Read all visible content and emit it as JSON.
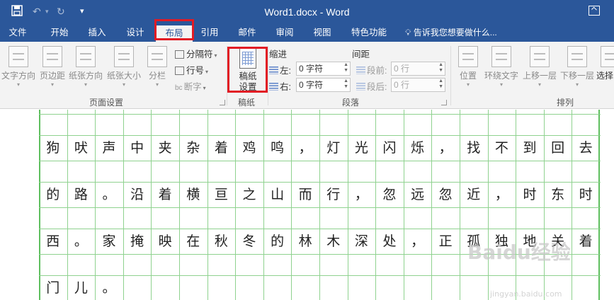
{
  "window": {
    "title": "Word1.docx - Word"
  },
  "tabs": [
    {
      "label": "文件"
    },
    {
      "label": "开始"
    },
    {
      "label": "插入"
    },
    {
      "label": "设计"
    },
    {
      "label": "布局",
      "active": true
    },
    {
      "label": "引用"
    },
    {
      "label": "邮件"
    },
    {
      "label": "审阅"
    },
    {
      "label": "视图"
    },
    {
      "label": "特色功能"
    }
  ],
  "tell_me": "告诉我您想要做什么...",
  "ribbon": {
    "page_setup": {
      "group_label": "页面设置",
      "buttons": [
        "文字方向",
        "页边距",
        "纸张方向",
        "纸张大小",
        "分栏"
      ],
      "breaks": "分隔符",
      "line_numbers": "行号",
      "hyphenation": "断字"
    },
    "manuscript": {
      "group_label": "稿纸",
      "button_line1": "稿纸",
      "button_line2": "设置"
    },
    "paragraph": {
      "group_label": "段落",
      "indent_title": "缩进",
      "spacing_title": "间距",
      "left_label": "左:",
      "left_value": "0 字符",
      "right_label": "右:",
      "right_value": "0 字符",
      "before_label": "段前:",
      "before_value": "0 行",
      "after_label": "段后:",
      "after_value": "0 行"
    },
    "arrange": {
      "group_label": "排列",
      "buttons": [
        "位置",
        "环绕文字",
        "上移一层",
        "下移一层",
        "选择"
      ]
    }
  },
  "document": {
    "rows": [
      [
        "狗",
        "吠",
        "声",
        "中",
        "夹",
        "杂",
        "着",
        "鸡",
        "鸣",
        "，",
        "灯",
        "光",
        "闪",
        "烁",
        "，",
        "找",
        "不",
        "到",
        "回",
        "去"
      ],
      [
        "的",
        "路",
        "。",
        "沿",
        "着",
        "横",
        "亘",
        "之",
        "山",
        "而",
        "行",
        "，",
        "忽",
        "远",
        "忽",
        "近",
        "，",
        "时",
        "东",
        "时"
      ],
      [
        "西",
        "。",
        "家",
        "掩",
        "映",
        "在",
        "秋",
        "冬",
        "的",
        "林",
        "木",
        "深",
        "处",
        "，",
        "正",
        "孤",
        "独",
        "地",
        "关",
        "着"
      ],
      [
        "门",
        "儿",
        "。",
        "",
        "",
        "",
        "",
        "",
        "",
        "",
        "",
        "",
        "",
        "",
        "",
        "",
        "",
        "",
        "",
        ""
      ]
    ]
  },
  "watermark": {
    "text": "Baidu经验",
    "sub": "jingyan.baidu.com"
  },
  "colors": {
    "title_bar": "#2b579a",
    "ribbon_bg": "#f3f3f3",
    "grid_line": "#8fd28f",
    "highlight": "#e21b24"
  }
}
